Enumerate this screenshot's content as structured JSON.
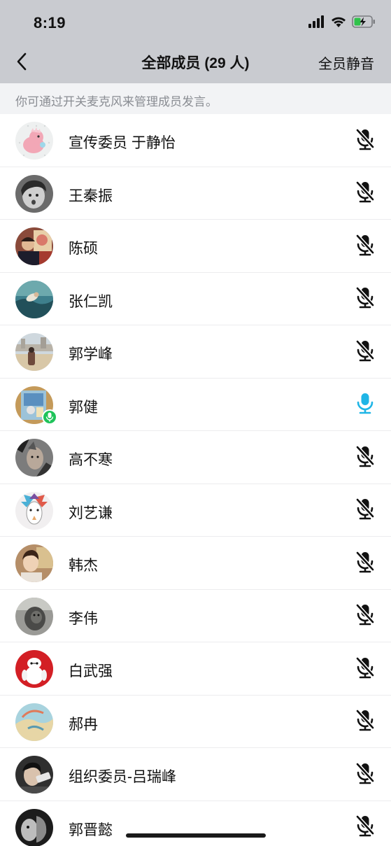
{
  "status_bar": {
    "time": "8:19",
    "icons": [
      "signal-icon",
      "wifi-icon",
      "battery-charging-icon"
    ]
  },
  "nav": {
    "back_icon": "chevron-left-icon",
    "title": "全部成员 (29 人)",
    "action_label": "全员静音"
  },
  "hint": "你可通过开关麦克风来管理成员发言。",
  "colors": {
    "header_bg": "#c9cbd0",
    "hint_bg": "#f2f3f5",
    "mic_active": "#1fb5e6",
    "mic_muted": "#111111",
    "speaking_badge": "#1fc35a"
  },
  "members": [
    {
      "name": "宣传委员 于静怡",
      "mic": "muted"
    },
    {
      "name": "王秦振",
      "mic": "muted"
    },
    {
      "name": "陈硕",
      "mic": "muted"
    },
    {
      "name": "张仁凯",
      "mic": "muted"
    },
    {
      "name": "郭学峰",
      "mic": "muted"
    },
    {
      "name": "郭健",
      "mic": "on",
      "speaking": true
    },
    {
      "name": "高不寒",
      "mic": "muted"
    },
    {
      "name": "刘艺谦",
      "mic": "muted"
    },
    {
      "name": "韩杰",
      "mic": "muted"
    },
    {
      "name": "李伟",
      "mic": "muted"
    },
    {
      "name": "白武强",
      "mic": "muted"
    },
    {
      "name": "郝冉",
      "mic": "muted"
    },
    {
      "name": "组织委员-吕瑞峰",
      "mic": "muted"
    },
    {
      "name": "郭晋懿",
      "mic": "muted"
    }
  ]
}
